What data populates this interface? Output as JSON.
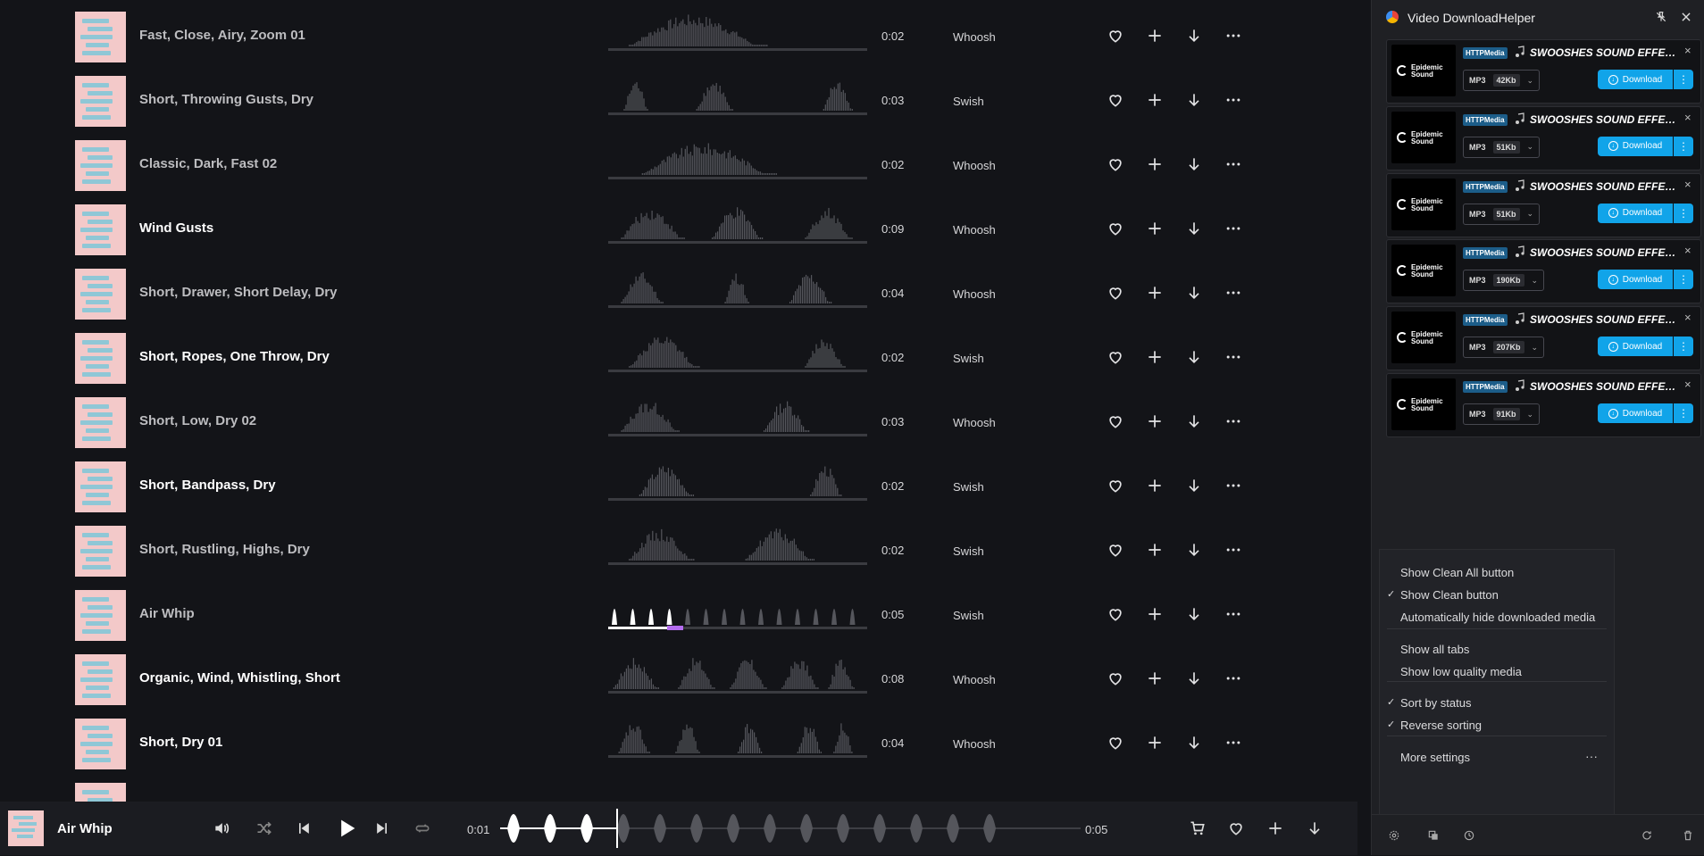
{
  "tracks": [
    {
      "title": "Fast, Close, Airy, Zoom 01",
      "duration": "0:02",
      "category": "Whoosh"
    },
    {
      "title": "Short, Throwing Gusts, Dry",
      "duration": "0:03",
      "category": "Swish"
    },
    {
      "title": "Classic, Dark, Fast 02",
      "duration": "0:02",
      "category": "Whoosh"
    },
    {
      "title": "Wind Gusts",
      "duration": "0:09",
      "category": "Whoosh"
    },
    {
      "title": "Short, Drawer, Short Delay, Dry",
      "duration": "0:04",
      "category": "Whoosh"
    },
    {
      "title": "Short, Ropes, One Throw, Dry",
      "duration": "0:02",
      "category": "Swish"
    },
    {
      "title": "Short, Low, Dry 02",
      "duration": "0:03",
      "category": "Whoosh"
    },
    {
      "title": "Short, Bandpass, Dry",
      "duration": "0:02",
      "category": "Swish"
    },
    {
      "title": "Short, Rustling, Highs, Dry",
      "duration": "0:02",
      "category": "Swish"
    },
    {
      "title": "Air Whip",
      "duration": "0:05",
      "category": "Swish"
    },
    {
      "title": "Organic, Wind, Whistling, Short",
      "duration": "0:08",
      "category": "Whoosh"
    },
    {
      "title": "Short, Dry 01",
      "duration": "0:04",
      "category": "Whoosh"
    }
  ],
  "player": {
    "title": "Air Whip",
    "current_time": "0:01",
    "total_time": "0:05",
    "progress_fraction": 0.2
  },
  "extension": {
    "title": "Video DownloadHelper",
    "thumb_brand": "Epidemic Sound",
    "items": [
      {
        "badge": "HTTPMedia",
        "title": "SWOOSHES SOUND EFFECTS",
        "format": "MP3",
        "size": "42Kb",
        "download_label": "Download"
      },
      {
        "badge": "HTTPMedia",
        "title": "SWOOSHES SOUND EFFECTS",
        "format": "MP3",
        "size": "51Kb",
        "download_label": "Download"
      },
      {
        "badge": "HTTPMedia",
        "title": "SWOOSHES SOUND EFFECTS",
        "format": "MP3",
        "size": "51Kb",
        "download_label": "Download"
      },
      {
        "badge": "HTTPMedia",
        "title": "SWOOSHES SOUND EFFECTS",
        "format": "MP3",
        "size": "190Kb",
        "download_label": "Download"
      },
      {
        "badge": "HTTPMedia",
        "title": "SWOOSHES SOUND EFFECTS",
        "format": "MP3",
        "size": "207Kb",
        "download_label": "Download"
      },
      {
        "badge": "HTTPMedia",
        "title": "SWOOSHES SOUND EFFECTS",
        "format": "MP3",
        "size": "91Kb",
        "download_label": "Download"
      }
    ],
    "menu": [
      {
        "label": "Show Clean All button",
        "checked": false
      },
      {
        "label": "Show Clean button",
        "checked": true
      },
      {
        "label": "Automatically hide downloaded media",
        "checked": false
      },
      {
        "label": "Show all tabs",
        "checked": false
      },
      {
        "label": "Show low quality media",
        "checked": false
      },
      {
        "label": "Sort by status",
        "checked": true
      },
      {
        "label": "Reverse sorting",
        "checked": true
      },
      {
        "label": "More settings",
        "checked": false
      }
    ],
    "colors": {
      "accent": "#11a4e9",
      "badge": "#1c5d89"
    }
  },
  "icons": {
    "row_actions": [
      "heart-icon",
      "plus-icon",
      "download-arrow-icon",
      "more-dots-icon"
    ],
    "player_controls": [
      "volume-icon",
      "shuffle-icon",
      "previous-icon",
      "play-icon",
      "next-icon",
      "repeat-icon",
      "cart-icon",
      "heart-icon",
      "plus-icon",
      "download-arrow-icon"
    ]
  }
}
